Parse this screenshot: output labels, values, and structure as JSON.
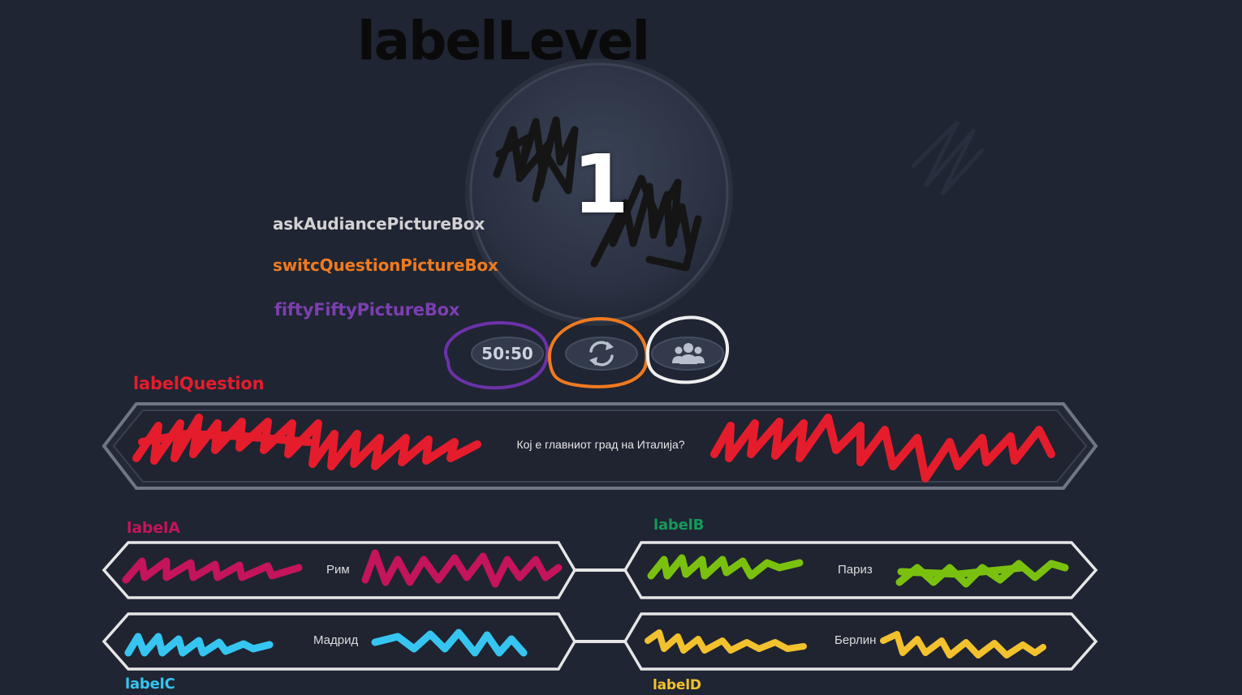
{
  "annotations": {
    "label_level": "labelLevel",
    "ask_audiance": "askAudiancePictureBox",
    "switch_question": "switcQuestionPictureBox",
    "fifty_fifty": "fiftyFiftyPictureBox",
    "label_question": "labelQuestion",
    "label_a": "labelA",
    "label_b": "labelB",
    "label_c": "labelC",
    "label_d": "labelD"
  },
  "level": "1",
  "lifelines": {
    "fifty_fifty_text": "50:50",
    "switch_icon": "refresh-icon",
    "audience_icon": "users-icon"
  },
  "question": "Кој е главниот град на Италија?",
  "answers": {
    "a": "Рим",
    "b": "Париз",
    "c": "Мадрид",
    "d": "Берлин"
  },
  "colors": {
    "background": "#1f2532",
    "ask_audiance": "#d2d2d2",
    "switch_question": "#f07a1f",
    "fifty_fifty": "#7c3fb0",
    "label_question": "#e51c2c",
    "label_a": "#c4145a",
    "label_b": "#149a5a",
    "label_c": "#36c5f0",
    "label_d": "#f2c12e"
  }
}
